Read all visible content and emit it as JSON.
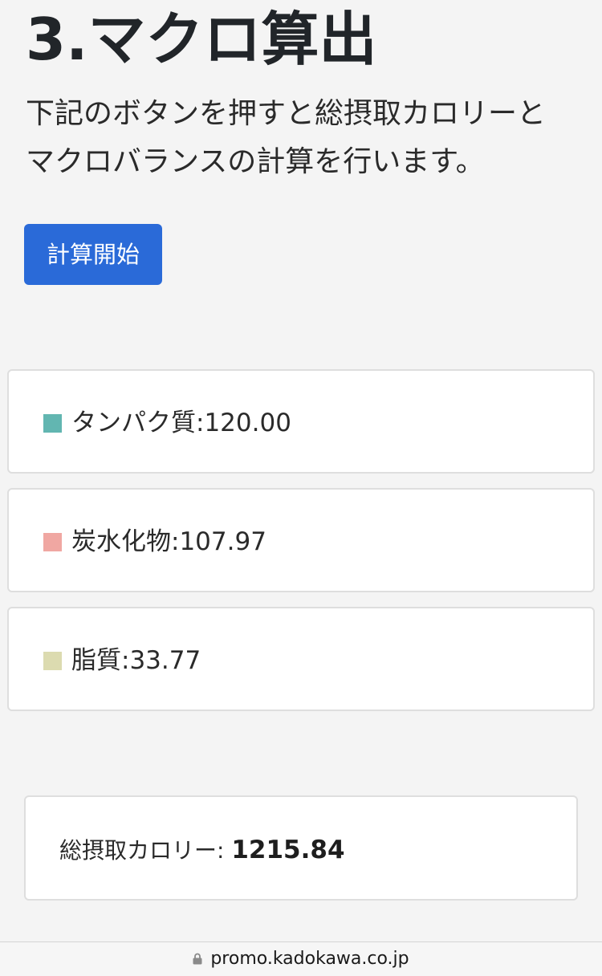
{
  "header": {
    "title": "3.マクロ算出"
  },
  "description": {
    "line1": "下記のボタンを押すと総摂取カロリーと",
    "line2": "マクロバランスの計算を行います。"
  },
  "actions": {
    "calculate_label": "計算開始"
  },
  "macros": [
    {
      "label": "タンパク質:120.00",
      "color": "#62b6b1",
      "icon": "square-swatch"
    },
    {
      "label": "炭水化物:107.97",
      "color": "#f0a7a2",
      "icon": "square-swatch"
    },
    {
      "label": "脂質:33.77",
      "color": "#dcdbb0",
      "icon": "square-swatch"
    }
  ],
  "total": {
    "label": "総摂取カロリー: ",
    "value": "1215.84"
  },
  "browser": {
    "url": "promo.kadokawa.co.jp",
    "lock_icon": "lock-icon"
  }
}
